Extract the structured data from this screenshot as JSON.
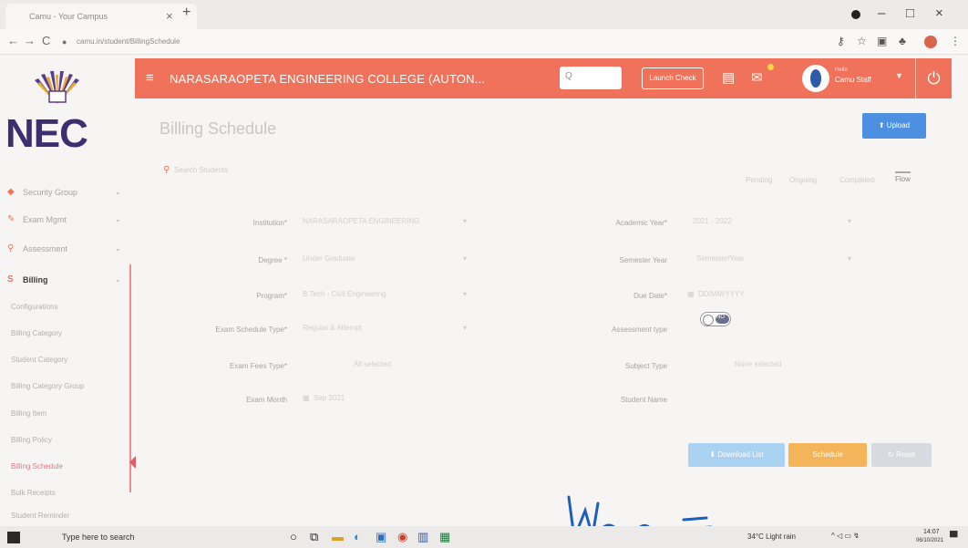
{
  "browser": {
    "tab_title": "Camu - Your Campus",
    "url": "camu.in/student/BillingSchedule",
    "icons": [
      "close-icon",
      "plus-icon",
      "back-icon",
      "forward-icon",
      "reload-icon",
      "lock-icon",
      "key-icon",
      "star-icon",
      "extensions-icon",
      "puzzle-icon",
      "profile-icon",
      "kebab-icon"
    ]
  },
  "header": {
    "college_name": "NARASARAOPETA ENGINEERING COLLEGE (AUTON...",
    "search_placeholder": "Q",
    "launch_button": "Launch Check",
    "user_role": "Hello",
    "user_name": "Camu Staff",
    "accent_color": "#f0725a"
  },
  "sidebar": {
    "logo_text": "NEC",
    "menu": [
      {
        "label": "Security Group",
        "icon": "shield-icon",
        "color": "#f0725a"
      },
      {
        "label": "Exam Mgmt",
        "icon": "pen-icon",
        "color": "#f0725a"
      },
      {
        "label": "Assessment",
        "icon": "search-icon",
        "color": "#f0725a"
      },
      {
        "label": "Billing",
        "icon": "dollar-icon",
        "color": "#f0725a"
      }
    ],
    "billing_items": [
      "Configurations",
      "Billing Category",
      "Student Category",
      "Billing Category Group",
      "Billing Item",
      "Billing Policy",
      "Billing Schedule",
      "Bulk Receipts",
      "Student Reminder"
    ]
  },
  "main": {
    "page_title": "Billing Schedule",
    "upload_button": "Upload",
    "search_placeholder": "Search Students",
    "tabs": [
      "Pending",
      "Ongoing",
      "Completed",
      "Flow"
    ],
    "fields_left": [
      {
        "label": "Institution*",
        "value": "NARASARAOPETA ENGINEERING"
      },
      {
        "label": "Degree *",
        "value": "Under Graduate"
      },
      {
        "label": "Program*",
        "value": "B.Tech - Civil Engineering"
      },
      {
        "label": "Exam Schedule Type*",
        "value": "Regular & Attempt"
      },
      {
        "label": "Exam Fees Type*",
        "value": "All selected"
      },
      {
        "label": "Exam Month",
        "value": "Sep 2021"
      }
    ],
    "fields_right": [
      {
        "label": "Academic Year*",
        "value": "2021 - 2022"
      },
      {
        "label": "Semester Year",
        "value": "Semester/Year"
      },
      {
        "label": "Due Date*",
        "value": "DD/MM/YYYY"
      },
      {
        "label": "Assessment type",
        "value": "NO"
      },
      {
        "label": "Subject Type",
        "value": "None selected"
      },
      {
        "label": "Student Name",
        "value": ""
      }
    ],
    "buttons": {
      "download": "Download List",
      "schedule": "Schedule",
      "reset": "Reset"
    }
  },
  "taskbar": {
    "search_placeholder": "Type here to search",
    "weather": "34°C Light rain",
    "time": "14:07",
    "date": "06/10/2021"
  }
}
